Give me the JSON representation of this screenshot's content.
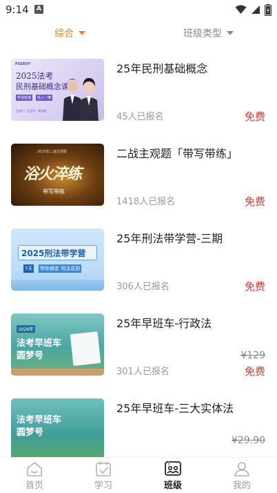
{
  "status_bar": {
    "time": "9:14",
    "notification_badge": "A"
  },
  "filters": {
    "sort_label": "综合",
    "type_label": "班级类型",
    "active_color": "#f0812a"
  },
  "courses": [
    {
      "title": "25年民刑基础概念",
      "enrolled": "45人已报名",
      "price": "免费",
      "original_price": "",
      "thumb": {
        "brand": "PSSBUY",
        "line1": "2025法考",
        "line2": "民刑基础概念课",
        "tag1": "学法有道",
        "tag2": "名人一律",
        "footer": "主讲人：王正平、李佳凯"
      }
    },
    {
      "title": "二战主观题「带写带练」",
      "enrolled": "1418人已报名",
      "price": "免费",
      "original_price": "",
      "thumb": {
        "top": "2025年二战主观题",
        "main": "浴火淬练",
        "sub": "带写带练"
      }
    },
    {
      "title": "25年刑法带学营-三期",
      "enrolled": "306人已报名",
      "price": "免费",
      "original_price": "",
      "thumb": {
        "main": "2025刑法带学营",
        "badge1": "7天",
        "badge2": "带你搞定 刑法总则"
      }
    },
    {
      "title": "25年早班车-行政法",
      "enrolled": "301人已报名",
      "price": "免费",
      "original_price": "¥129",
      "thumb": {
        "year": "2026年",
        "line1": "法考早班车",
        "line2": "圆梦号"
      }
    },
    {
      "title": "25年早班车-三大实体法",
      "enrolled": "",
      "price": "",
      "original_price": "¥29.90",
      "thumb": {
        "line1": "法考早班车",
        "line2": "圆梦号"
      }
    }
  ],
  "tabs": [
    {
      "label": "首页",
      "icon": "home-icon"
    },
    {
      "label": "学习",
      "icon": "calendar-check-icon"
    },
    {
      "label": "班级",
      "icon": "class-group-icon"
    },
    {
      "label": "我的",
      "icon": "person-icon"
    }
  ],
  "colors": {
    "price_red": "#e8362c",
    "muted": "#999999"
  }
}
